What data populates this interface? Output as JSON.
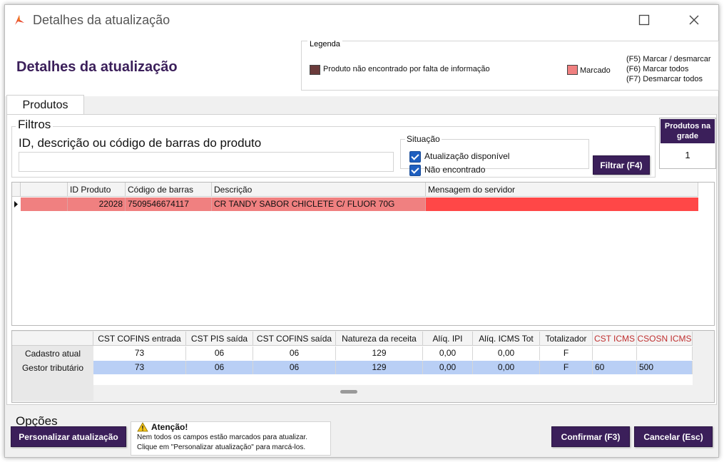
{
  "window": {
    "title": "Detalhes da atualização"
  },
  "header": {
    "page_title": "Detalhes da atualização"
  },
  "legend": {
    "title": "Legenda",
    "not_found_label": "Produto não encontrado por falta de informação",
    "not_found_color": "#6b3b3b",
    "marked_label": "Marcado",
    "marked_color": "#f08080",
    "shortcut_f5": "(F5) Marcar / desmarcar",
    "shortcut_f6": "(F6) Marcar todos",
    "shortcut_f7": "(F7) Desmarcar todos"
  },
  "tabs": [
    {
      "label": "Produtos"
    }
  ],
  "filters": {
    "title": "Filtros",
    "search_label": "ID, descrição ou código de barras do produto",
    "search_value": "",
    "situacao_title": "Situação",
    "check_available_label": "Atualização disponível",
    "check_available": true,
    "check_not_found_label": "Não encontrado",
    "check_not_found": true,
    "filter_button": "Filtrar (F4)",
    "count_label": "Produtos na grade",
    "count_value": "1"
  },
  "grid": {
    "columns": [
      "ID Produto",
      "Código de barras",
      "Descrição",
      "Mensagem do servidor"
    ],
    "rows": [
      {
        "id": "22028",
        "barcode": "7509546674117",
        "description": "CR TANDY SABOR CHICLETE C/ FLUOR 70G",
        "message": ""
      }
    ]
  },
  "details": {
    "columns": [
      "CST COFINS entrada",
      "CST PIS saída",
      "CST COFINS saída",
      "Natureza da receita",
      "Alíq. IPI",
      "Alíq. ICMS Tot",
      "Totalizador",
      "CST ICMS",
      "CSOSN ICMS"
    ],
    "rows": [
      {
        "label": "Cadastro atual",
        "values": [
          "73",
          "06",
          "06",
          "129",
          "0,00",
          "0,00",
          "F",
          "",
          ""
        ]
      },
      {
        "label": "Gestor tributário",
        "values": [
          "73",
          "06",
          "06",
          "129",
          "0,00",
          "0,00",
          "F",
          "60",
          "500"
        ]
      }
    ]
  },
  "options": {
    "title": "Opções",
    "customize_button": "Personalizar atualização",
    "warning_title": "Atenção!",
    "warning_line1": "Nem todos os campos estão marcados para atualizar.",
    "warning_line2": "Clique em \"Personalizar atualização\" para marcá-los.",
    "confirm_button": "Confirmar (F3)",
    "cancel_button": "Cancelar (Esc)"
  }
}
